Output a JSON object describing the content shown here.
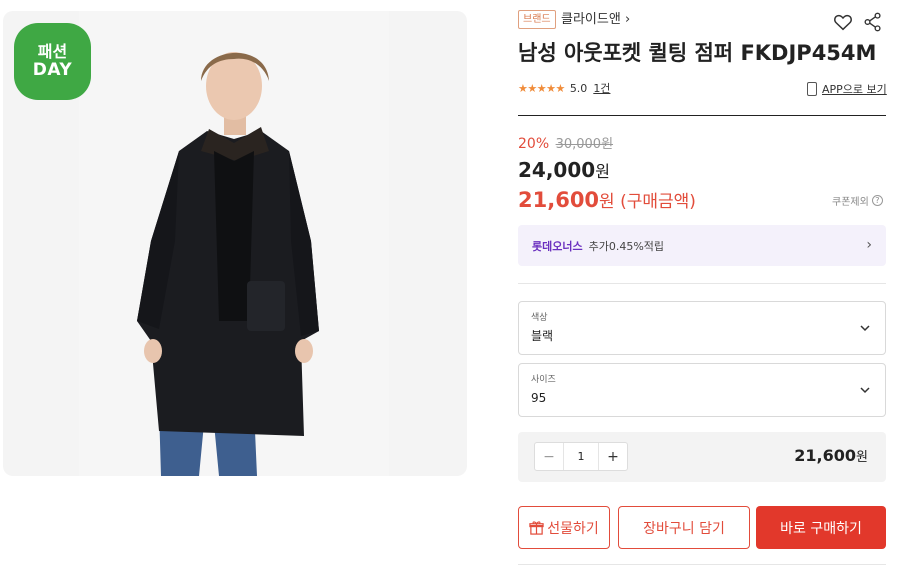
{
  "product_image": {
    "badge_line1": "패션",
    "badge_line2": "DAY"
  },
  "brand": {
    "tag": "브랜드",
    "name": "클라이드앤"
  },
  "product": {
    "title": "남성 아웃포켓 퀼팅 점퍼 FKDJP454M",
    "rating": "5.0",
    "stars": "★★★★★",
    "review_count": "1건",
    "app_link": "APP으로 보기"
  },
  "price": {
    "discount_rate": "20%",
    "original_price": "30,000원",
    "sale_price": "24,000",
    "sale_unit": "원",
    "final_price": "21,600",
    "final_unit": "원 (구매금액)",
    "coupon_note": "쿠폰제외",
    "info_symbol": "?"
  },
  "points": {
    "brand": "롯데오너스",
    "text": "추가0.45%적립"
  },
  "options": [
    {
      "label": "색상",
      "value": "블랙"
    },
    {
      "label": "사이즈",
      "value": "95"
    }
  ],
  "quantity": {
    "minus": "−",
    "value": "1",
    "plus": "+",
    "total": "21,600",
    "total_unit": "원"
  },
  "actions": {
    "gift": "선물하기",
    "cart": "장바구니 담기",
    "buy": "바로 구매하기"
  },
  "colors": {
    "accent": "#e2382b",
    "badge_green": "#3fa844",
    "star": "#f08c3a",
    "points_purple": "#6a2fbf"
  }
}
